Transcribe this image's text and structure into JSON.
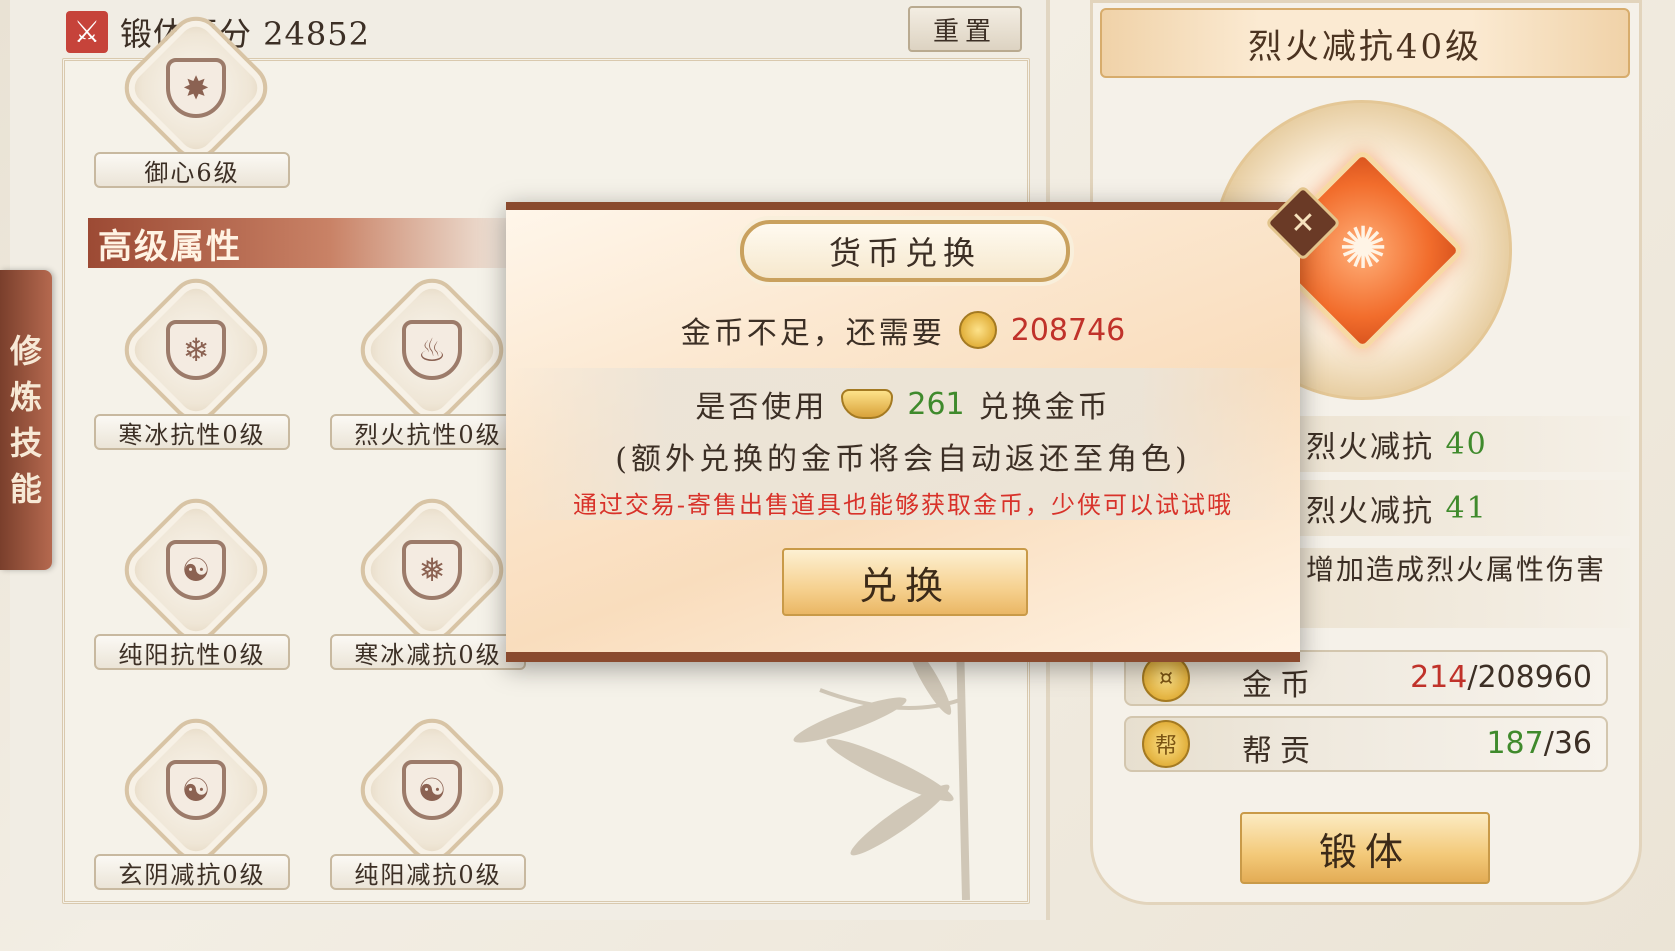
{
  "side_tab": {
    "chars": [
      "修",
      "炼",
      "技",
      "能"
    ]
  },
  "header": {
    "score_label": "锻体评分 24852",
    "reset_label": "重置"
  },
  "section": {
    "title": "高级属性"
  },
  "skills": [
    {
      "label": "御心6级",
      "glyph": "✸"
    },
    {
      "label": "寒冰抗性0级",
      "glyph": "❄"
    },
    {
      "label": "烈火抗性0级",
      "glyph": "♨"
    },
    {
      "label": "纯阳抗性0级",
      "glyph": "☯"
    },
    {
      "label": "寒冰减抗0级",
      "glyph": "❅"
    },
    {
      "label": "玄阴减抗0级",
      "glyph": "☯"
    },
    {
      "label": "纯阳减抗0级",
      "glyph": "☯"
    }
  ],
  "detail": {
    "title": "烈火减抗40级",
    "emblem_glyph": "✺",
    "current": {
      "name": "烈火减抗",
      "value": "40"
    },
    "next": {
      "name": "烈火减抗",
      "value": "41"
    },
    "description": "增加造成烈火属性伤害",
    "resources": [
      {
        "icon": "gold-coin-icon",
        "icon_glyph": "¤",
        "name": "金币",
        "have": "214",
        "need": "/208960",
        "have_color": "#c0322a"
      },
      {
        "icon": "guild-token-icon",
        "icon_glyph": "帮",
        "name": "帮贡",
        "have": "187",
        "need": "/36",
        "have_color": "#3f8a2c"
      }
    ],
    "forge_label": "锻体"
  },
  "modal": {
    "title": "货币兑换",
    "close_glyph": "✕",
    "need_text": "金币不足，还需要",
    "need_value": "208746",
    "use_prefix": "是否使用",
    "use_value": "261",
    "use_suffix": "兑换金币",
    "note": "(额外兑换的金币将会自动返还至角色)",
    "tip": "通过交易-寄售出售道具也能够获取金币，少侠可以试试哦",
    "exchange_label": "兑换"
  }
}
